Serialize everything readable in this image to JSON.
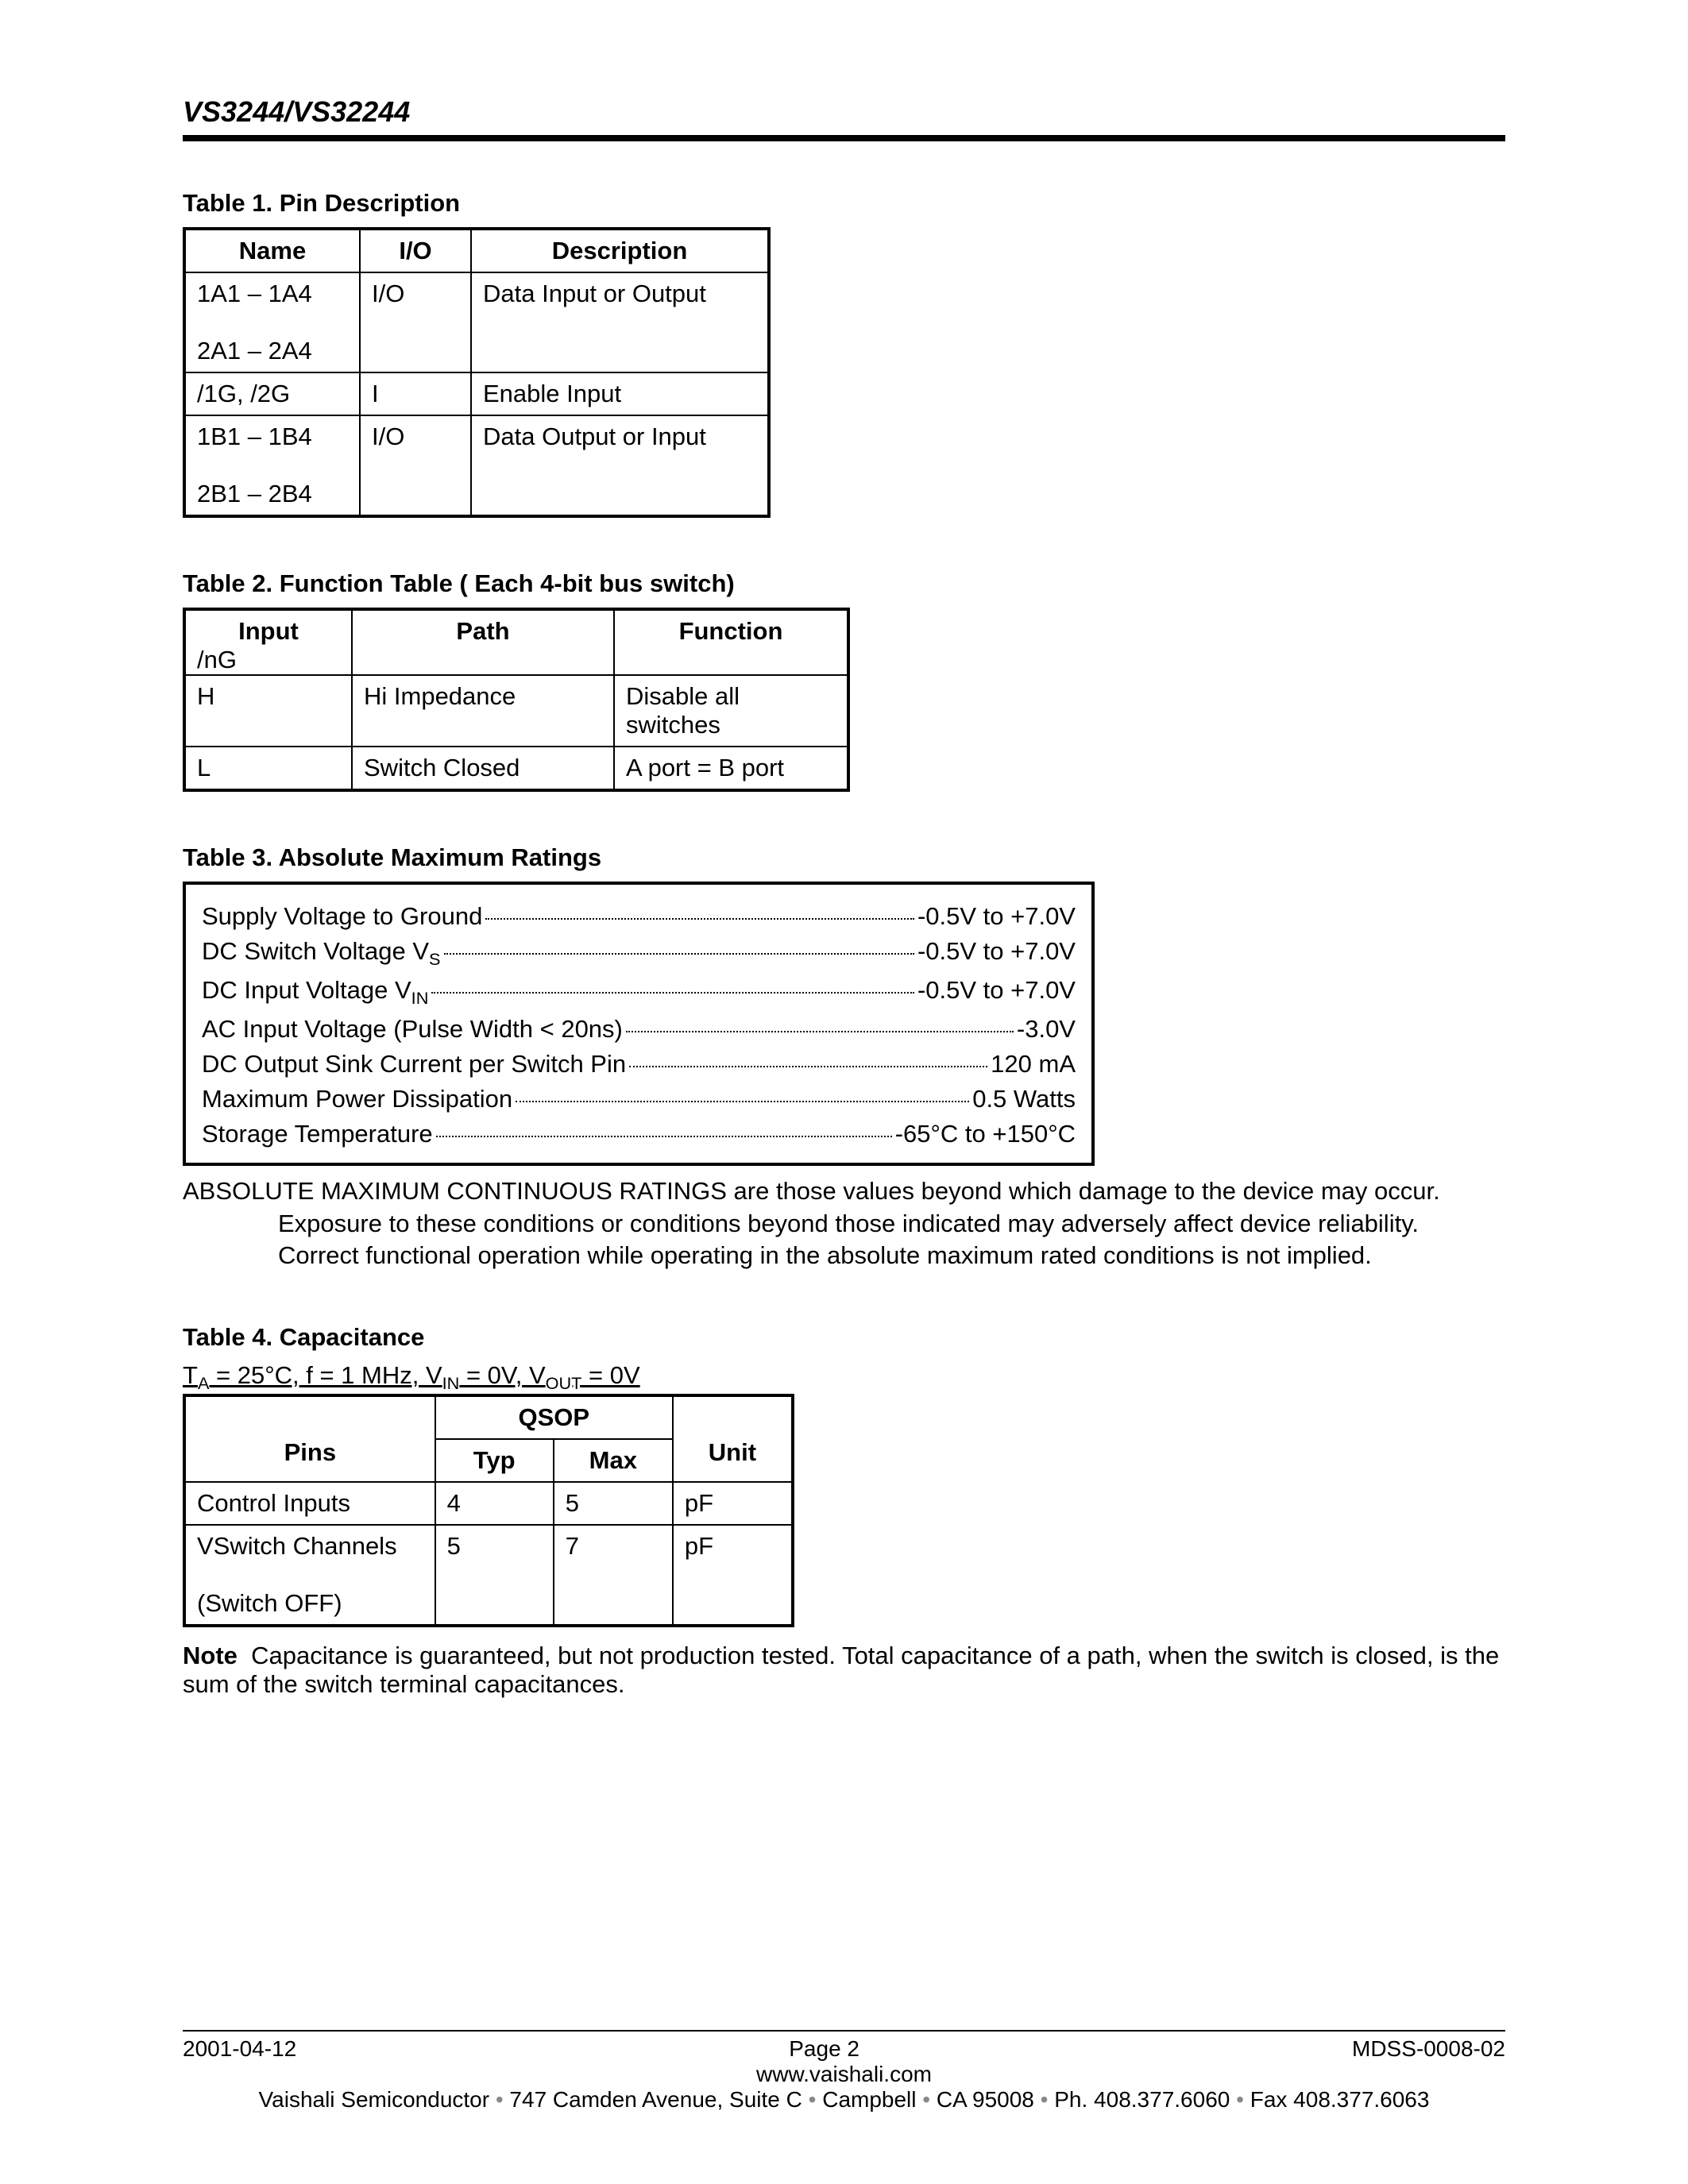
{
  "header": {
    "title": "VS3244/VS32244"
  },
  "table1": {
    "title": "Table 1.  Pin Description",
    "headers": [
      "Name",
      "I/O",
      "Description"
    ],
    "rows": [
      {
        "name_a": "1A1 – 1A4",
        "name_b": "2A1 – 2A4",
        "io": "I/O",
        "desc": "Data Input or Output"
      },
      {
        "name_a": "/1G, /2G",
        "name_b": "",
        "io": "I",
        "desc": "Enable Input"
      },
      {
        "name_a": "1B1 – 1B4",
        "name_b": "2B1 – 2B4",
        "io": "I/O",
        "desc": "Data Output or Input"
      }
    ]
  },
  "table2": {
    "title": "Table 2.  Function Table ( Each 4-bit bus switch)",
    "headers": [
      "Input",
      "Path",
      "Function"
    ],
    "subheader": "/nG",
    "rows": [
      {
        "in": "H",
        "path": "Hi Impedance",
        "fn": "Disable all switches"
      },
      {
        "in": "L",
        "path": "Switch Closed",
        "fn": "A port = B port"
      }
    ]
  },
  "table3": {
    "title": "Table 3.  Absolute Maximum Ratings",
    "rows": [
      {
        "label": "Supply Voltage to Ground",
        "val": "-0.5V to +7.0V"
      },
      {
        "label_html": "DC Switch Voltage V<sub>S</sub>",
        "val": "-0.5V to +7.0V"
      },
      {
        "label_html": "DC Input Voltage V<sub>IN</sub>",
        "val": "-0.5V to +7.0V"
      },
      {
        "label": "AC Input Voltage (Pulse Width < 20ns)",
        "val": "-3.0V"
      },
      {
        "label": "DC Output Sink Current per Switch Pin",
        "val": "120 mA"
      },
      {
        "label": "Maximum Power Dissipation",
        "val": "0.5 Watts"
      },
      {
        "label": "Storage Temperature",
        "val_html": "-65°C to +150°C"
      }
    ],
    "note1": "ABSOLUTE MAXIMUM CONTINUOUS RATINGS are those values beyond which damage to the device may occur.",
    "note2": "Exposure to these conditions or conditions beyond those indicated may adversely affect device reliability.",
    "note3": "Correct functional operation while operating in the absolute maximum rated conditions is not implied."
  },
  "table4": {
    "title": "Table 4.  Capacitance",
    "cond_html": "T<sub>A</sub> = 25°C, f = 1 MHz, V<sub>IN</sub> = 0V, V<sub>OUT</sub> = 0V",
    "group": "QSOP",
    "headers": {
      "pins": "Pins",
      "typ": "Typ",
      "max": "Max",
      "unit": "Unit"
    },
    "rows": [
      {
        "pins": "Control Inputs",
        "typ": "4",
        "max": "5",
        "unit": "pF"
      },
      {
        "pins_a": "VSwitch Channels",
        "pins_b": "(Switch OFF)",
        "typ": "5",
        "max": "7",
        "unit": "pF"
      }
    ],
    "note_label": "Note",
    "note_text": "Capacitance is guaranteed, but not production tested. Total capacitance of a path, when the switch is closed, is the sum of the switch terminal capacitances."
  },
  "footer": {
    "date": "2001-04-12",
    "page": "Page 2",
    "doc": "MDSS-0008-02",
    "url": "www.vaishali.com",
    "addr": "Vaishali Semiconductor • 747 Camden Avenue, Suite C • Campbell • CA 95008 • Ph. 408.377.6060 • Fax 408.377.6063"
  }
}
